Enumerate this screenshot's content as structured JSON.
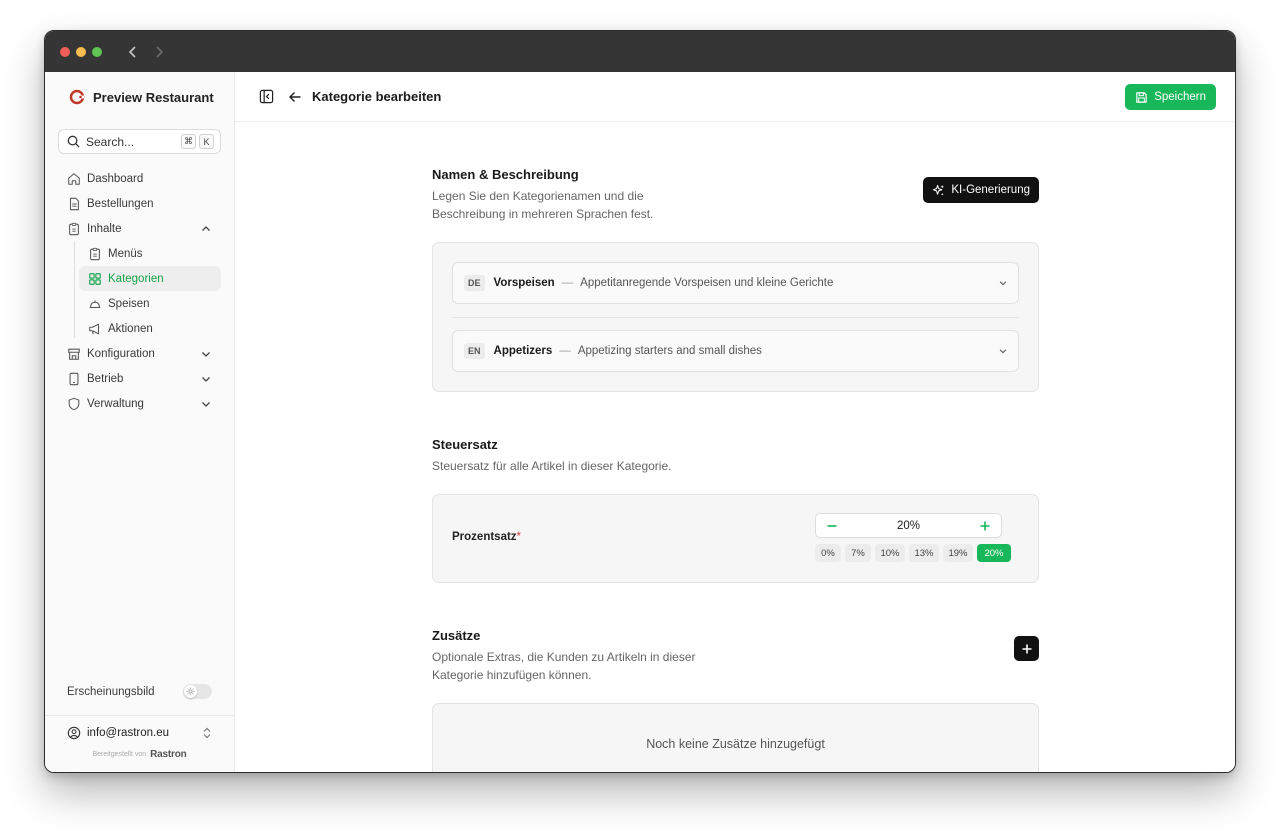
{
  "app": {
    "restaurant_name": "Preview Restaurant",
    "search_placeholder": "Search...",
    "search_kbd_1": "⌘",
    "search_kbd_2": "K"
  },
  "sidebar": {
    "items": [
      {
        "label": "Dashboard"
      },
      {
        "label": "Bestellungen"
      },
      {
        "label": "Inhalte"
      },
      {
        "label": "Menüs"
      },
      {
        "label": "Kategorien"
      },
      {
        "label": "Speisen"
      },
      {
        "label": "Aktionen"
      },
      {
        "label": "Konfiguration"
      },
      {
        "label": "Betrieb"
      },
      {
        "label": "Verwaltung"
      }
    ],
    "appearance_label": "Erscheinungsbild",
    "user_email": "info@rastron.eu",
    "powered_by": "Bereitgestellt von",
    "powered_brand": "Rastron"
  },
  "topbar": {
    "title": "Kategorie bearbeiten",
    "save_label": "Speichern"
  },
  "names_section": {
    "title": "Namen & Beschreibung",
    "desc_line1": "Legen Sie den Kategorienamen und die",
    "desc_line2": "Beschreibung in mehreren Sprachen fest.",
    "ai_label": "KI-Generierung",
    "languages": [
      {
        "code": "DE",
        "name": "Vorspeisen",
        "dash": "—",
        "desc": "Appetitanregende Vorspeisen und kleine Gerichte"
      },
      {
        "code": "EN",
        "name": "Appetizers",
        "dash": "—",
        "desc": "Appetizing starters and small dishes"
      }
    ]
  },
  "tax_section": {
    "title": "Steuersatz",
    "desc": "Steuersatz für alle Artikel in dieser Kategorie.",
    "field_label": "Prozentsatz",
    "required_mark": "*",
    "value": "20%",
    "presets": [
      "0%",
      "7%",
      "10%",
      "13%",
      "19%",
      "20%"
    ],
    "selected_preset": "20%"
  },
  "addons_section": {
    "title": "Zusätze",
    "desc_line1": "Optionale Extras, die Kunden zu Artikeln in dieser",
    "desc_line2": "Kategorie hinzufügen können.",
    "empty_text": "Noch keine Zusätze hinzugefügt"
  },
  "colors": {
    "accent": "#18b75a",
    "active_nav_text": "#17a34a",
    "titlebar": "#353535",
    "dot_red": "#ee5f57",
    "dot_yellow": "#f5bd4f",
    "dot_green": "#5fc453"
  }
}
